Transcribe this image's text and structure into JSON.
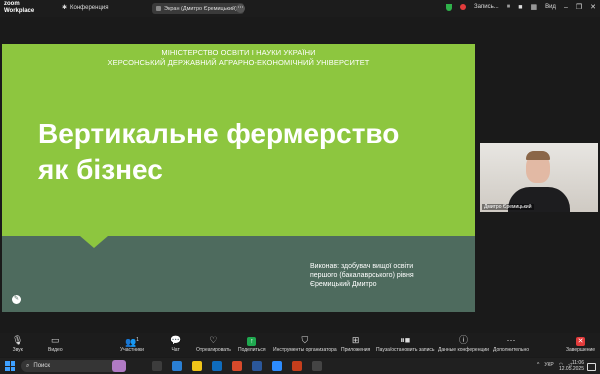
{
  "topbar": {
    "logo_line1": "zoom",
    "logo_line2": "Workplace",
    "conference_label": "Конференция",
    "screen_share_label": "Экран (Дмитро Єремицький)",
    "recording_label": "Запись...",
    "view_label": "Вид"
  },
  "slide": {
    "header_line1": "МІНІСТЕРСТВО ОСВІТИ І НАУКИ УКРАЇНИ",
    "header_line2": "ХЕРСОНСЬКИЙ ДЕРЖАВНИЙ АГРАРНО-ЕКОНОМІЧНИЙ УНІВЕРСИТЕТ",
    "title_line1": "Вертикальне фермерство",
    "title_line2": "як бізнес",
    "author_line1": "Виконав: здобувач вищої освіти",
    "author_line2": "першого (бакалаврського) рівня",
    "author_line3": "Єремицький Дмитро"
  },
  "video": {
    "participant_name": "Дмитро Єремицький"
  },
  "toolbar": {
    "audio": "Звук",
    "video": "Видео",
    "participants": "Участники",
    "participants_count": "1",
    "chat": "Чат",
    "react": "Отреагировать",
    "share": "Поделиться",
    "host_tools": "Инструменты организатора",
    "apps": "Приложения",
    "pause_record": "Пауза/остановить запись",
    "meeting_info": "Данные конференции",
    "more": "Дополнительно",
    "end": "Завершение"
  },
  "taskbar": {
    "search_placeholder": "Поиск",
    "language": "УКР",
    "time": "11:06",
    "date": "12.05.2025"
  }
}
